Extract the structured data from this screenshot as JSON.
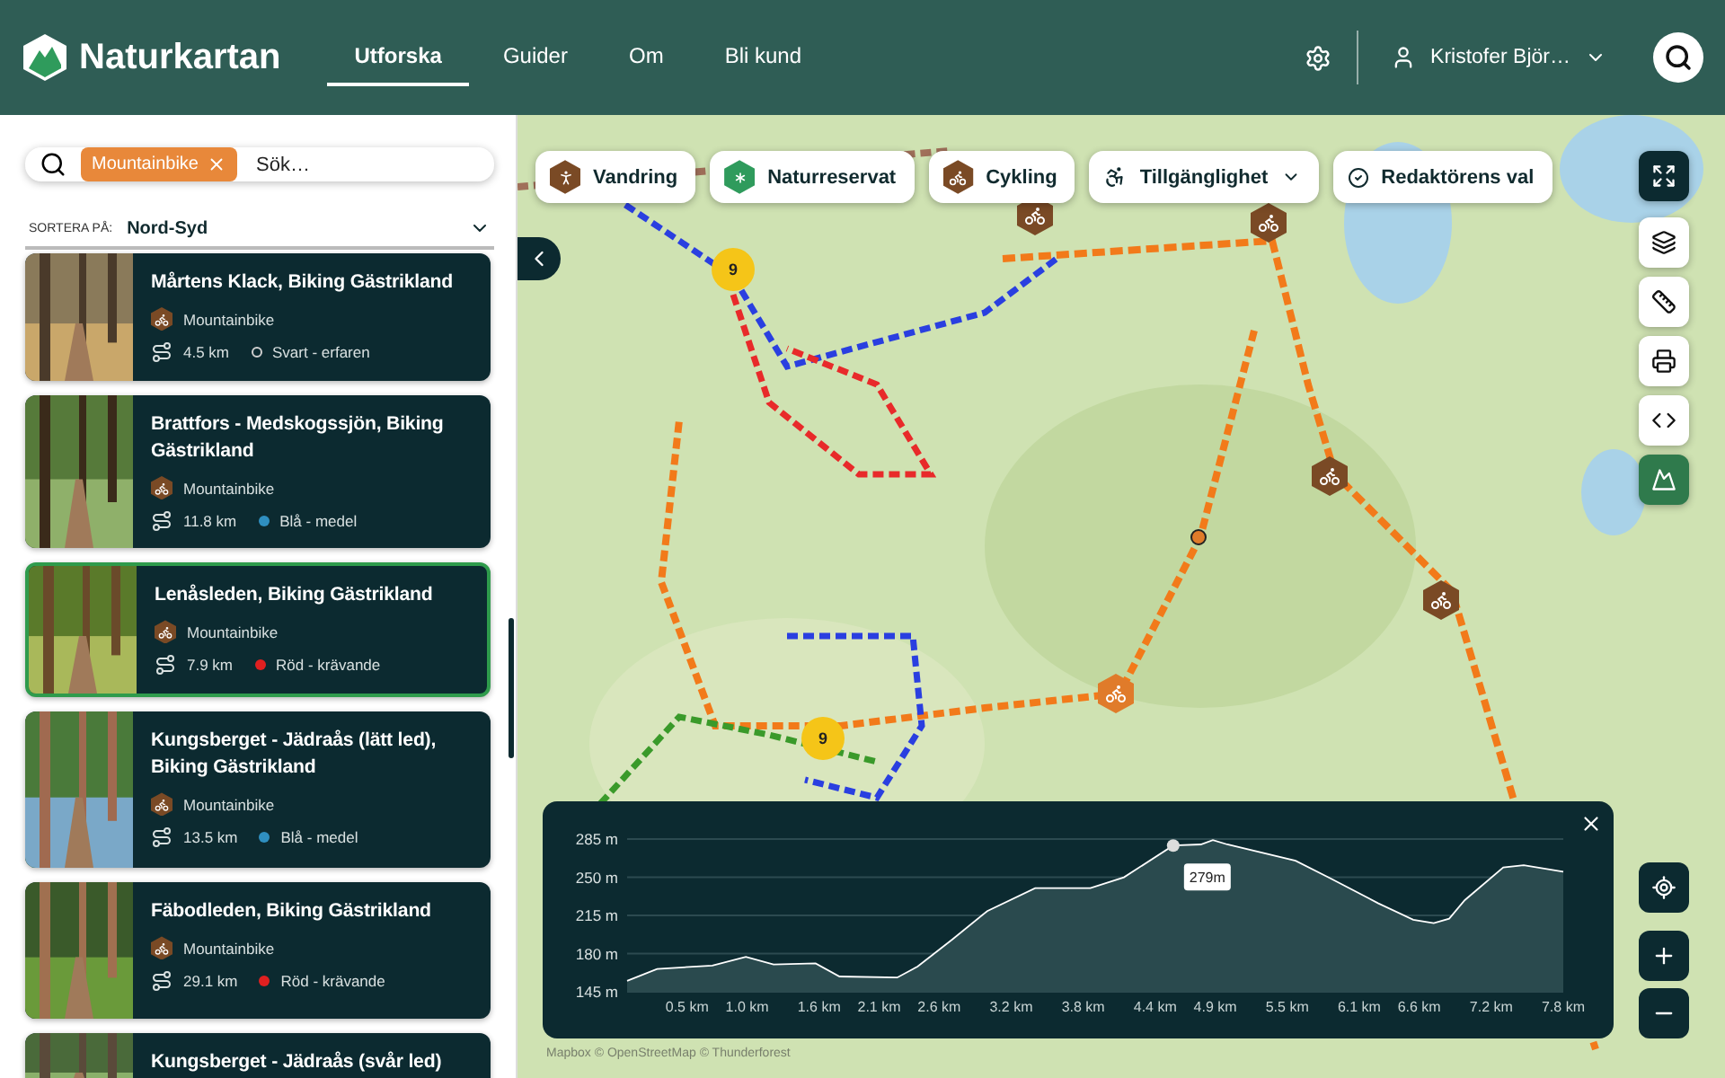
{
  "header": {
    "logo": "Naturkartan",
    "nav": [
      {
        "label": "Utforska",
        "selected": true
      },
      {
        "label": "Guider",
        "selected": false
      },
      {
        "label": "Om",
        "selected": false
      },
      {
        "label": "Bli kund",
        "selected": false
      }
    ],
    "user": "Kristofer Björ…"
  },
  "sidebar": {
    "search": {
      "tag": "Mountainbike",
      "placeholder": "Sök…"
    },
    "sort": {
      "label": "SORTERA PÅ:",
      "value": "Nord-Syd"
    },
    "cards": [
      {
        "title": "Mårtens Klack, Biking Gästrikland",
        "category": "Mountainbike",
        "distance": "4.5 km",
        "difficulty": "Svart - erfaren",
        "color": "#d0d0d0",
        "hollow": true,
        "selected": false
      },
      {
        "title": "Brattfors - Medskogssjön, Biking Gästrikland",
        "category": "Mountainbike",
        "distance": "11.8 km",
        "difficulty": "Blå - medel",
        "color": "#2f8fc0",
        "hollow": false,
        "selected": false
      },
      {
        "title": "Lenåsleden, Biking Gästrikland",
        "category": "Mountainbike",
        "distance": "7.9 km",
        "difficulty": "Röd - krävande",
        "color": "#e02020",
        "hollow": false,
        "selected": true
      },
      {
        "title": "Kungsberget - Jädraås (lätt led), Biking Gästrikland",
        "category": "Mountainbike",
        "distance": "13.5 km",
        "difficulty": "Blå - medel",
        "color": "#2f8fc0",
        "hollow": false,
        "selected": false
      },
      {
        "title": "Fäbodleden, Biking Gästrikland",
        "category": "Mountainbike",
        "distance": "29.1 km",
        "difficulty": "Röd - krävande",
        "color": "#e02020",
        "hollow": false,
        "selected": false
      },
      {
        "title": "Kungsberget - Jädraås (svår led)",
        "selected": false
      }
    ]
  },
  "map": {
    "filters": [
      {
        "kind": "hike",
        "label": "Vandring"
      },
      {
        "kind": "reserve",
        "label": "Naturreservat"
      },
      {
        "kind": "bike",
        "label": "Cykling"
      },
      {
        "kind": "access",
        "label": "Tillgänglighet",
        "dropdown": true
      },
      {
        "kind": "editor",
        "label": "Redaktörens val"
      }
    ],
    "markers": [
      {
        "kind": "cluster",
        "count": "9"
      },
      {
        "kind": "cluster",
        "count": "9"
      },
      {
        "kind": "bike"
      },
      {
        "kind": "bike"
      },
      {
        "kind": "bike"
      },
      {
        "kind": "bike"
      },
      {
        "kind": "bike-active"
      },
      {
        "kind": "point"
      }
    ],
    "tools": [
      {
        "kind": "fullscreen",
        "active": true
      },
      {
        "kind": "layers",
        "active": false
      },
      {
        "kind": "ruler",
        "active": false
      },
      {
        "kind": "print",
        "active": false
      },
      {
        "kind": "embed",
        "active": false
      },
      {
        "kind": "elevation",
        "active": true
      }
    ],
    "attribution": "Mapbox © OpenStreetMap © Thunderforest",
    "elevation": {
      "chart_data": {
        "type": "area",
        "x": [
          0,
          0.25,
          0.71,
          0.99,
          1.22,
          1.57,
          1.77,
          2.25,
          2.42,
          2.71,
          3.0,
          3.4,
          3.86,
          4.14,
          4.55,
          4.78,
          4.88,
          5.0,
          5.57,
          5.86,
          6.26,
          6.55,
          6.72,
          6.85,
          6.98,
          7.3,
          7.47,
          7.8
        ],
        "series": [
          {
            "color": "#ffffff",
            "values": [
              155,
              166,
              169,
              177,
              170,
              171,
              159,
              158,
              168,
              193,
              219,
              240,
              240,
              250,
              279,
              280,
              284,
              280,
              265,
              249,
              226,
              211,
              208,
              212,
              229,
              259,
              261,
              255
            ]
          }
        ],
        "grid": true,
        "xlim": [
          0,
          7.8
        ],
        "ylim": [
          145,
          285
        ],
        "xticks": [
          {
            "value": 0.5,
            "label": "0.5 km"
          },
          {
            "value": 1.0,
            "label": "1.0 km"
          },
          {
            "value": 1.6,
            "label": "1.6 km"
          },
          {
            "value": 2.1,
            "label": "2.1 km"
          },
          {
            "value": 2.6,
            "label": "2.6 km"
          },
          {
            "value": 3.2,
            "label": "3.2 km"
          },
          {
            "value": 3.8,
            "label": "3.8 km"
          },
          {
            "value": 4.4,
            "label": "4.4 km"
          },
          {
            "value": 4.9,
            "label": "4.9 km"
          },
          {
            "value": 5.5,
            "label": "5.5 km"
          },
          {
            "value": 6.1,
            "label": "6.1 km"
          },
          {
            "value": 6.6,
            "label": "6.6 km"
          },
          {
            "value": 7.2,
            "label": "7.2 km"
          },
          {
            "value": 7.8,
            "label": "7.8 km"
          }
        ],
        "yticks": [
          {
            "value": 145,
            "label": "145 m"
          },
          {
            "value": 180,
            "label": "180 m"
          },
          {
            "value": 215,
            "label": "215 m"
          },
          {
            "value": 250,
            "label": "250 m"
          },
          {
            "value": 285,
            "label": "285 m"
          }
        ],
        "annotations": [
          {
            "x": 4.55,
            "y": 279,
            "text": "279m"
          }
        ]
      }
    }
  }
}
